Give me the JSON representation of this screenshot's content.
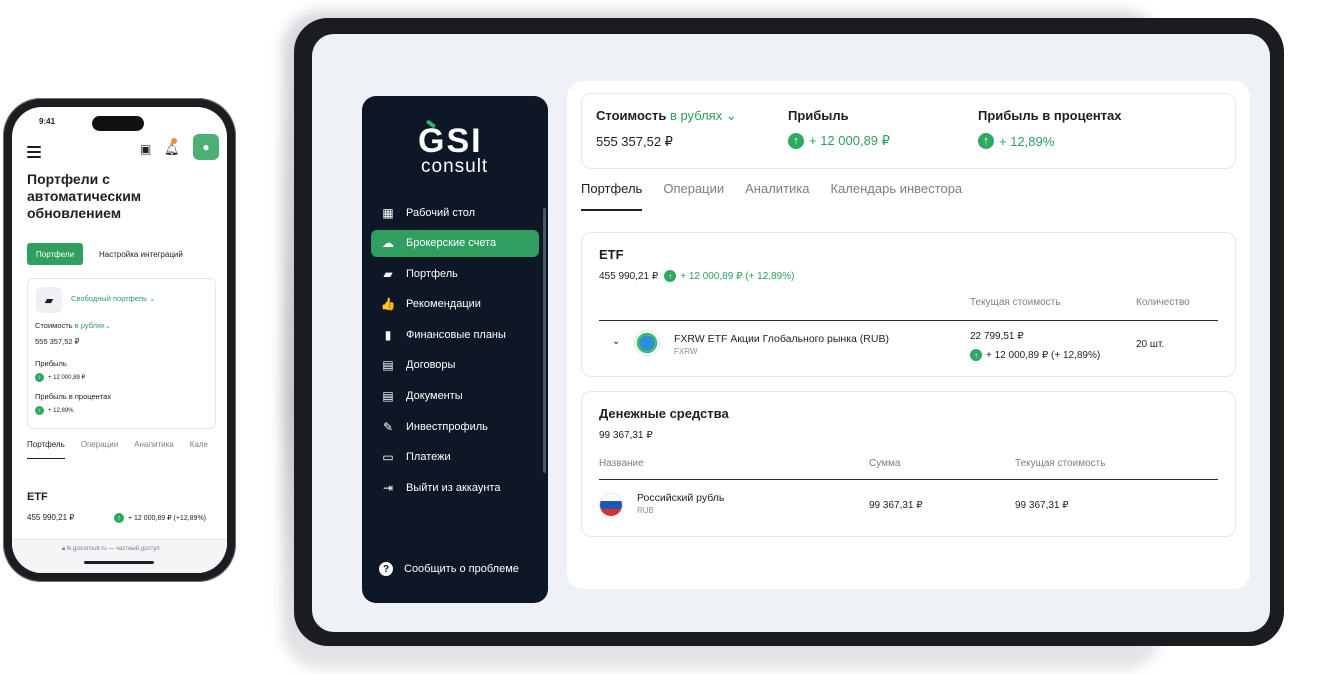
{
  "desktop": {
    "logo": {
      "line1": "GSI",
      "line2": "consult"
    },
    "menu": [
      {
        "label": "Рабочий стол",
        "icon": "dashboard-icon",
        "glyph": "▦",
        "active": false
      },
      {
        "label": "Брокерские счета",
        "icon": "cloud-icon",
        "glyph": "☁",
        "active": true
      },
      {
        "label": "Портфель",
        "icon": "briefcase-icon",
        "glyph": "▰",
        "active": false
      },
      {
        "label": "Рекомендации",
        "icon": "thumbs-up-icon",
        "glyph": "👍",
        "active": false
      },
      {
        "label": "Финансовые планы",
        "icon": "bar-chart-icon",
        "glyph": "▮",
        "active": false
      },
      {
        "label": "Договоры",
        "icon": "clipboard-icon",
        "glyph": "▤",
        "active": false
      },
      {
        "label": "Документы",
        "icon": "document-icon",
        "glyph": "▤",
        "active": false
      },
      {
        "label": "Инвестпрофиль",
        "icon": "profile-edit-icon",
        "glyph": "✎",
        "active": false
      },
      {
        "label": "Платежи",
        "icon": "payment-icon",
        "glyph": "▭",
        "active": false
      },
      {
        "label": "Выйти из аккаунта",
        "icon": "logout-icon",
        "glyph": "⇥",
        "active": false
      }
    ],
    "help_label": "Сообщить о проблеме",
    "summary": {
      "cost_label": "Стоимость",
      "currency_label": "в рублях",
      "cost_value": "555 357,52 ₽",
      "profit_label": "Прибыль",
      "profit_value": "+ 12 000,89 ₽",
      "profit_pct_label": "Прибыль в процентах",
      "profit_pct_value": "+ 12,89%"
    },
    "tabs": [
      "Портфель",
      "Операции",
      "Аналитика",
      "Календарь инвестора"
    ],
    "etf": {
      "title": "ETF",
      "total": "455 990,21 ₽",
      "change": "+ 12 000,89 ₽ (+ 12,89%)",
      "columns": [
        "Текущая стоимость",
        "Количество"
      ],
      "row": {
        "name": "FXRW ETF Акции Глобального рынка (RUB)",
        "ticker": "FXRW",
        "value": "22 799,51 ₽",
        "change": "+ 12 000,89 ₽ (+ 12,89%)",
        "qty": "20 шт."
      }
    },
    "cash": {
      "title": "Денежные средства",
      "total": "99 367,31 ₽",
      "columns": [
        "Название",
        "Сумма",
        "Текущая стоимость"
      ],
      "row": {
        "name": "Российский рубль",
        "code": "RUB",
        "amount": "99 367,31 ₽",
        "value": "99 367,31 ₽"
      }
    }
  },
  "phone": {
    "time": "9:41",
    "title": "Портфели с автоматическим обновлением",
    "btn_portfolios": "Портфели",
    "btn_integrations": "Настройка интеграций",
    "portfolio_name": "Свободный портфель",
    "cost_label": "Стоимость",
    "currency_label": "в рублях",
    "cost_value": "555 357,52 ₽",
    "profit_label": "Прибыль",
    "profit_value": "+ 12 000,89 ₽",
    "profit_pct_label": "Прибыль в процентах",
    "profit_pct_value": "+ 12,89%",
    "tabs": [
      "Портфель",
      "Операции",
      "Аналитика",
      "Кале"
    ],
    "etf_title": "ETF",
    "etf_total": "455 990,21 ₽",
    "etf_change": "+ 12 000,89 ₽ (+12,89%)",
    "url": "lk.gsiconsult.ru",
    "url_suffix": "— частный доступ"
  },
  "colors": {
    "accent": "#2f9e5f",
    "sidebar": "#0d1726",
    "background": "#eef1f5"
  }
}
